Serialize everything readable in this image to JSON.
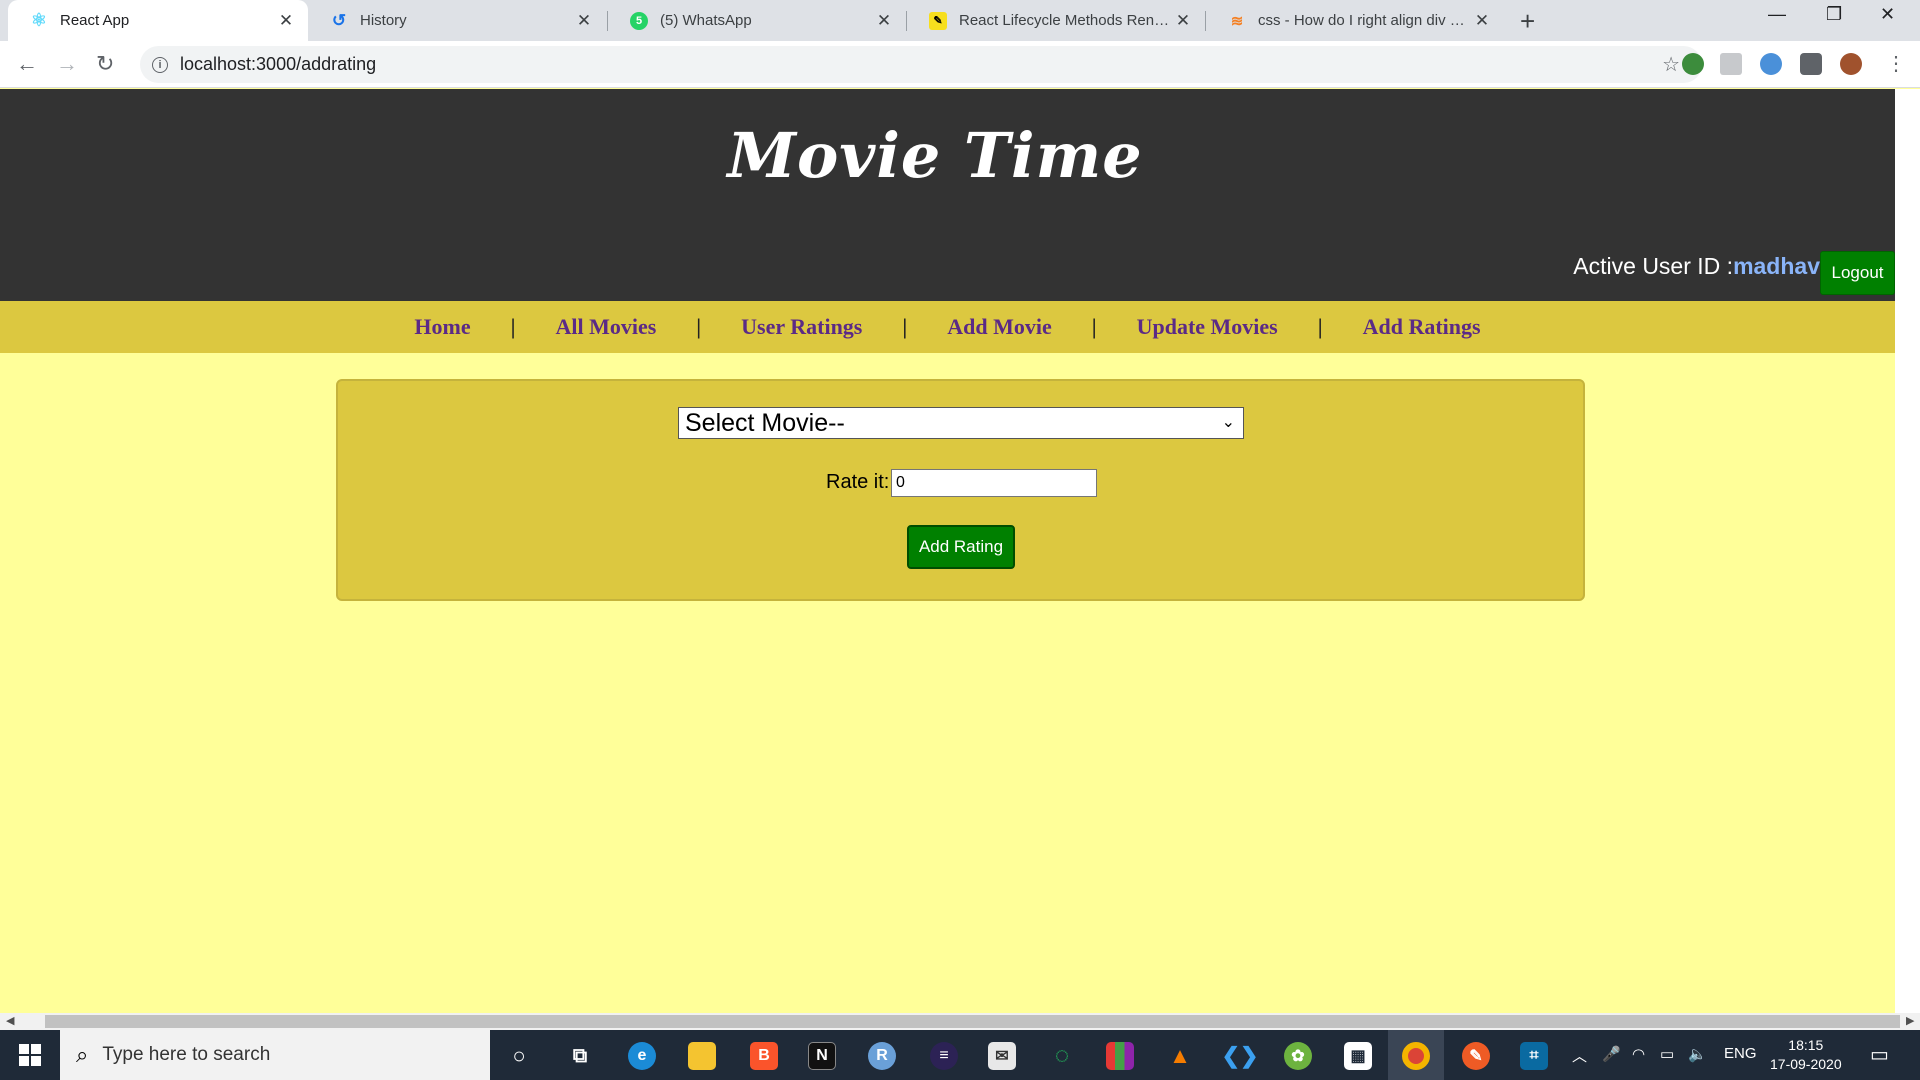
{
  "browser": {
    "tabs": [
      {
        "title": "React App",
        "active": true
      },
      {
        "title": "History",
        "active": false
      },
      {
        "title": "(5) WhatsApp",
        "active": false
      },
      {
        "title": "React Lifecycle Methods Render /",
        "active": false
      },
      {
        "title": "css - How do I right align div eler",
        "active": false
      }
    ],
    "url": "localhost:3000/addrating"
  },
  "app": {
    "brand": "Movie Time",
    "active_user_label": "Active User ID :",
    "active_user_id": "madhav",
    "logout_label": "Logout",
    "nav": [
      "Home",
      "All Movies",
      "User Ratings",
      "Add Movie",
      "Update Movies",
      "Add Ratings"
    ],
    "nav_separator": "|",
    "form": {
      "select_movie": "Select Movie--",
      "rate_label": "Rate it:",
      "rate_value": "0",
      "submit_label": "Add Rating"
    }
  },
  "taskbar": {
    "search_placeholder": "Type here to search",
    "language": "ENG",
    "time": "18:15",
    "date": "17-09-2020"
  },
  "colors": {
    "header": "#333333",
    "navbar": "#dcc840",
    "page": "#ffff99",
    "nav_link": "#5b2a86",
    "button": "#008000"
  }
}
